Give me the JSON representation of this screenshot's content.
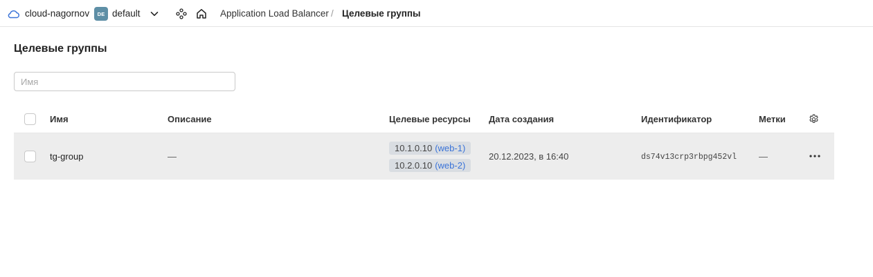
{
  "header": {
    "cloud_name": "cloud-nagornov",
    "folder_badge": "DE",
    "folder_name": "default",
    "breadcrumb": {
      "service": "Application Load Balancer",
      "separator": "/",
      "current": "Целевые группы"
    }
  },
  "page": {
    "title": "Целевые группы",
    "search_placeholder": "Имя",
    "search_value": ""
  },
  "table": {
    "columns": {
      "name": "Имя",
      "description": "Описание",
      "resources": "Целевые ресурсы",
      "created": "Дата создания",
      "id": "Идентификатор",
      "labels": "Метки"
    },
    "rows": [
      {
        "name": "tg-group",
        "description": "—",
        "resources": [
          {
            "ip": "10.1.0.10",
            "vm": "(web-1)"
          },
          {
            "ip": "10.2.0.10",
            "vm": "(web-2)"
          }
        ],
        "created": "20.12.2023, в 16:40",
        "id": "ds74v13crp3rbpg452vl",
        "labels": "—"
      }
    ]
  },
  "colors": {
    "accent": "#3a73d8",
    "folder_badge": "#5e8fa6",
    "row_background": "#ededed",
    "tag_background": "#d9dde2"
  },
  "icons": [
    "cloud-icon",
    "chevron-down-icon",
    "services-icon",
    "home-icon",
    "gear-icon",
    "more-icon"
  ]
}
